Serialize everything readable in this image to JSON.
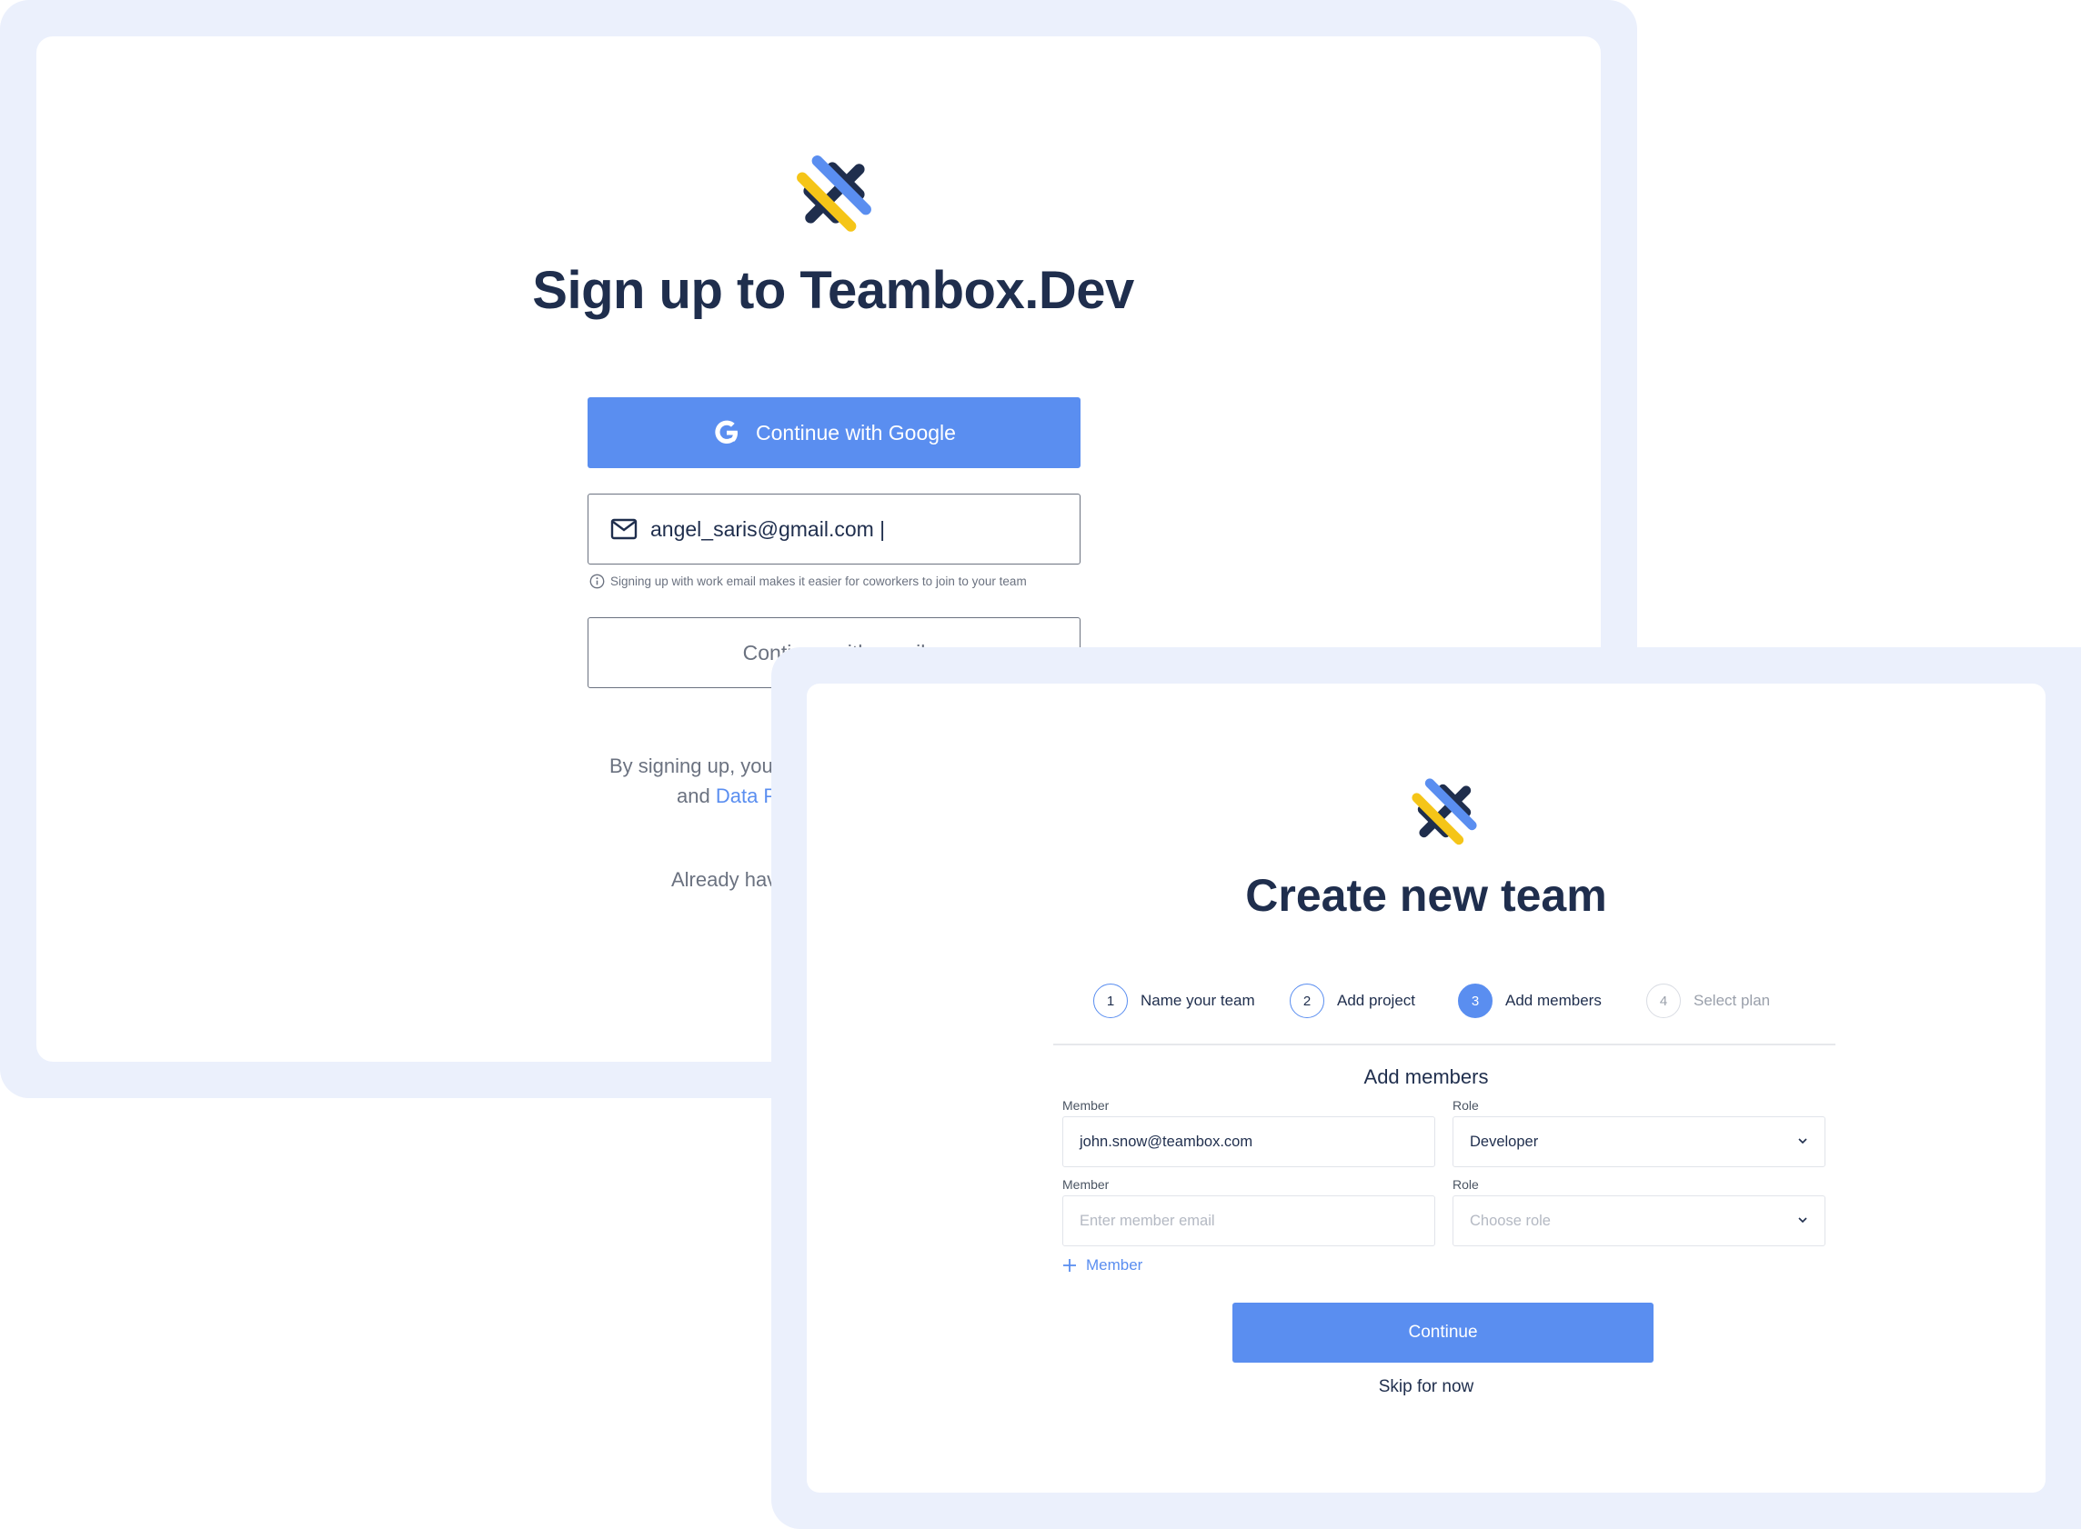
{
  "signup": {
    "title": "Sign up to Teambox.Dev",
    "google_button": "Continue with Google",
    "email_value": "angel_saris@gmail.com |",
    "email_hint": "Signing up with work email makes it easier for coworkers to join to your team",
    "email_button": "Continue with email",
    "terms_line1": "By signing up, you ag",
    "terms_line2_prefix": "and ",
    "terms_link": "Data Proc",
    "login_line": "Already have a"
  },
  "team": {
    "title": "Create new team",
    "steps": [
      {
        "number": "1",
        "label": "Name your team",
        "state": "done"
      },
      {
        "number": "2",
        "label": "Add project",
        "state": "done"
      },
      {
        "number": "3",
        "label": "Add members",
        "state": "active"
      },
      {
        "number": "4",
        "label": "Select plan",
        "state": "future"
      }
    ],
    "section_title": "Add members",
    "rows": [
      {
        "member_label": "Member",
        "member_value": "john.snow@teambox.com",
        "role_label": "Role",
        "role_value": "Developer"
      },
      {
        "member_label": "Member",
        "member_placeholder": "Enter member email",
        "role_label": "Role",
        "role_placeholder": "Choose role"
      }
    ],
    "add_member": "Member",
    "continue_button": "Continue",
    "skip_link": "Skip for now"
  },
  "colors": {
    "primary": "#5a8ef0",
    "navy": "#1f2e4d",
    "logo_yellow": "#f5c518",
    "logo_blue": "#5a8ef0",
    "logo_navy": "#1f2e4d",
    "frame_bg": "#ebf0fc"
  },
  "icons": [
    "teambox-logo",
    "google-icon",
    "mail-icon",
    "info-icon",
    "chevron-down-icon",
    "plus-icon"
  ]
}
